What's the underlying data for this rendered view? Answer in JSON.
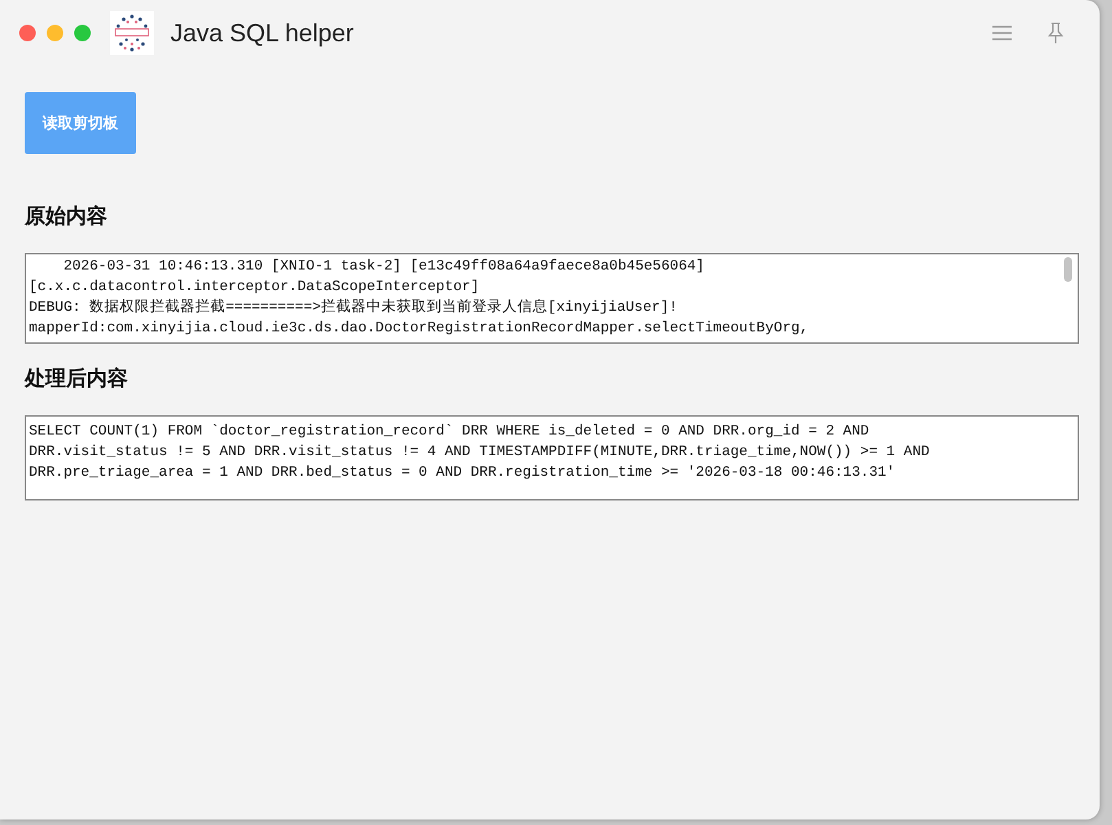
{
  "window": {
    "title": "Java SQL helper"
  },
  "toolbar": {
    "button": "读取剪切板"
  },
  "sections": [
    {
      "heading": "原始内容",
      "scrollable": true,
      "lines": [
        "    2026-03-31 10:46:13.310 [XNIO-1 task-2] [e13c49ff08a64a9faece8a0b45e56064]",
        "[c.x.c.datacontrol.interceptor.DataScopeInterceptor]",
        "DEBUG: 数据权限拦截器拦截==========>拦截器中未获取到当前登录人信息[xinyijiaUser]!",
        "mapperId:com.xinyijia.cloud.ie3c.ds.dao.DoctorRegistrationRecordMapper.selectTimeoutByOrg,"
      ]
    },
    {
      "heading": "处理后内容",
      "scrollable": false,
      "lines": [
        "SELECT COUNT(1) FROM `doctor_registration_record` DRR WHERE is_deleted = 0 AND DRR.org_id = 2 AND",
        "DRR.visit_status != 5 AND DRR.visit_status != 4 AND TIMESTAMPDIFF(MINUTE,DRR.triage_time,NOW()) >= 1 AND",
        "DRR.pre_triage_area = 1 AND DRR.bed_status = 0 AND DRR.registration_time >= '2026-03-18 00:46:13.31'"
      ]
    }
  ]
}
